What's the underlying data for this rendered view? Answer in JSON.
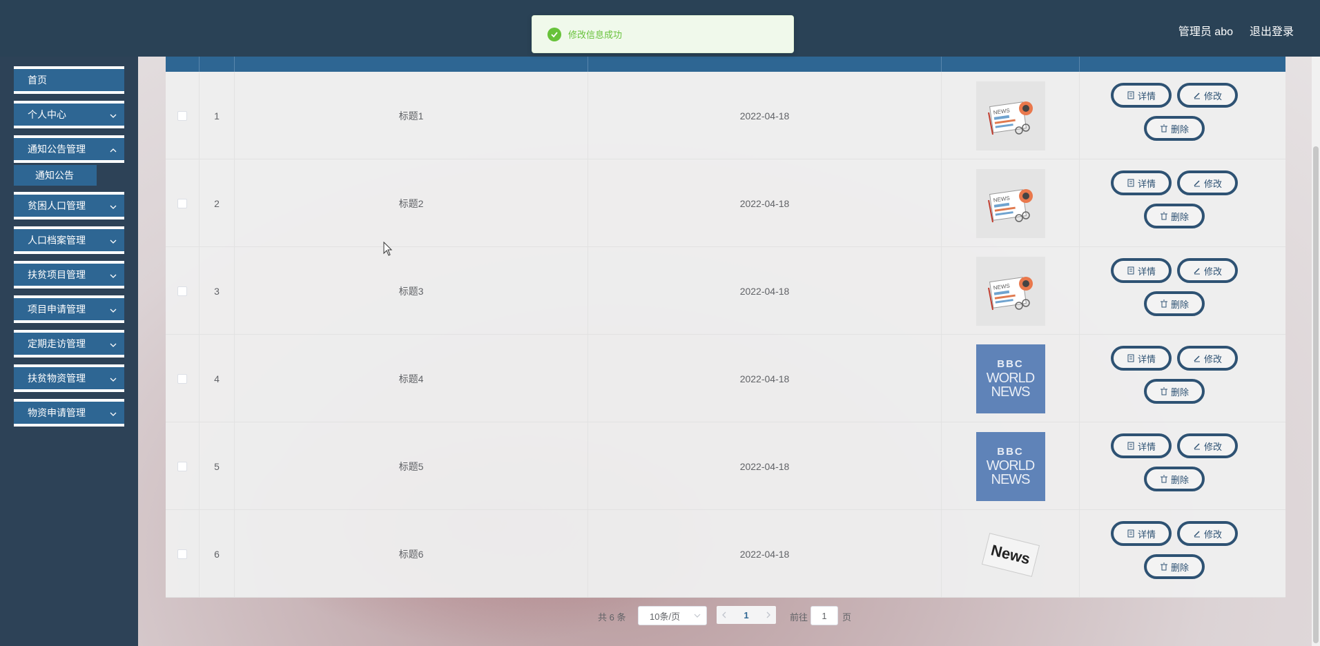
{
  "header": {
    "user_label": "管理员 abo",
    "logout_label": "退出登录"
  },
  "toast": {
    "message": "修改信息成功",
    "icon": "check-circle-icon",
    "color": "#67c23a"
  },
  "sidebar": {
    "items": [
      {
        "label": "首页",
        "has_children": false
      },
      {
        "label": "个人中心",
        "has_children": true
      },
      {
        "label": "通知公告管理",
        "has_children": true,
        "expanded": true
      },
      {
        "label": "贫困人口管理",
        "has_children": true
      },
      {
        "label": "人口档案管理",
        "has_children": true
      },
      {
        "label": "扶贫项目管理",
        "has_children": true
      },
      {
        "label": "项目申请管理",
        "has_children": true
      },
      {
        "label": "定期走访管理",
        "has_children": true
      },
      {
        "label": "扶贫物资管理",
        "has_children": true
      },
      {
        "label": "物资申请管理",
        "has_children": true
      }
    ],
    "subitem": "通知公告"
  },
  "table": {
    "rows": [
      {
        "index": "1",
        "title": "标题1",
        "date": "2022-04-18",
        "image": "news-paper"
      },
      {
        "index": "2",
        "title": "标题2",
        "date": "2022-04-18",
        "image": "news-paper"
      },
      {
        "index": "3",
        "title": "标题3",
        "date": "2022-04-18",
        "image": "news-paper"
      },
      {
        "index": "4",
        "title": "标题4",
        "date": "2022-04-18",
        "image": "bbc-world-news"
      },
      {
        "index": "5",
        "title": "标题5",
        "date": "2022-04-18",
        "image": "bbc-world-news"
      },
      {
        "index": "6",
        "title": "标题6",
        "date": "2022-04-18",
        "image": "news-stamp"
      }
    ],
    "actions": {
      "detail": "详情",
      "edit": "修改",
      "delete": "删除"
    },
    "image_text": {
      "bbc": "BBC",
      "world": "WORLD",
      "news": "NEWS",
      "news_small": "NEWS",
      "stamp": "News"
    }
  },
  "pagination": {
    "total": "共 6 条",
    "page_size": "10条/页",
    "current_page": "1",
    "goto_label": "前往",
    "goto_value": "1",
    "page_unit": "页"
  },
  "colors": {
    "header_bg": "#2a4256",
    "menu_bg": "#2e6693",
    "button_border": "#2e5273"
  }
}
